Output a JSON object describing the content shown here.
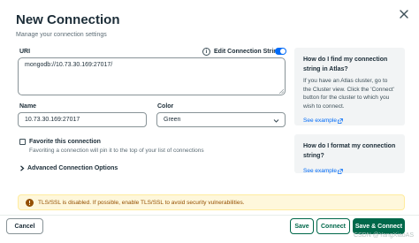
{
  "dialog": {
    "title": "New Connection",
    "subtitle": "Manage your connection settings"
  },
  "uri": {
    "label": "URI",
    "info_icon": "i",
    "edit_toggle_label": "Edit Connection String",
    "edit_toggle_on": true,
    "value": "mongodb://10.73.30.169:27017/"
  },
  "name": {
    "label": "Name",
    "value": "10.73.30.169:27017"
  },
  "color": {
    "label": "Color",
    "selected": "Green"
  },
  "favorite": {
    "label": "Favorite this connection",
    "description": "Favoriting a connection will pin it to the top of your list of connections",
    "checked": false
  },
  "advanced": {
    "label": "Advanced Connection Options"
  },
  "help_cards": [
    {
      "title": "How do I find my connection string in Atlas?",
      "body": "If you have an Atlas cluster, go to the Cluster view. Click the 'Connect' button for the cluster to which you wish to connect.",
      "link": "See example"
    },
    {
      "title": "How do I format my connection string?",
      "body": "",
      "link": "See example"
    }
  ],
  "banner": {
    "text": "TLS/SSL is disabled. If possible, enable TLS/SSL to avoid security vulnerabilities.",
    "icon": "warning-icon"
  },
  "footer": {
    "cancel_label": "Cancel",
    "save_label": "Save",
    "connect_label": "Connect",
    "save_connect_label": "Save & Connect"
  },
  "watermark": "CSDN @YangXiaoAS",
  "colors": {
    "primary_green": "#00684a",
    "toggle_blue": "#016bf8",
    "warning_bg": "#fef7db",
    "warning_text": "#944f01"
  }
}
